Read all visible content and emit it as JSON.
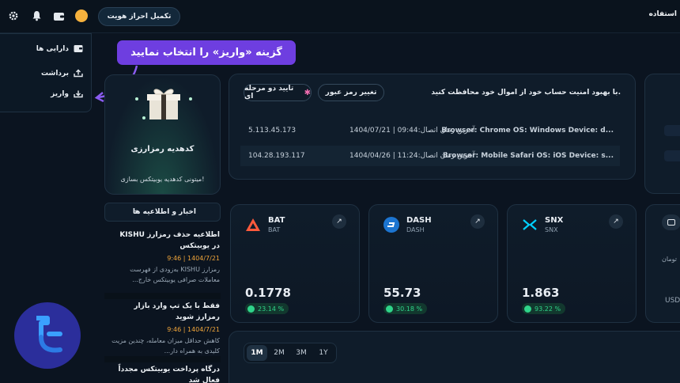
{
  "header": {
    "verify_button": "تکمیل احراز هویت",
    "user_label": "استفاده"
  },
  "menu": {
    "items": [
      {
        "label": "دارایی ها",
        "icon": "wallet-icon"
      },
      {
        "label": "برداشت",
        "icon": "upload-icon"
      },
      {
        "label": "واریز",
        "icon": "download-icon"
      }
    ]
  },
  "callout": {
    "text": "گزینه «واریز» را انتخاب نمایید"
  },
  "gift_card": {
    "title": "کدهدیه رمزارزی",
    "subtitle": "میتونی کدهدیه یوبیتکس بسازی!"
  },
  "security": {
    "message": "با بهبود امنیت حساب خود از اموال خود محافظت کنید.",
    "change_password": "تغییر رمز عبور",
    "two_factor": "تایید دو مرحله ای",
    "sessions": [
      {
        "browser": "Browser: Chrome OS: Windows Device: d...",
        "last_login": "آخرین زمان اتصال:09:44 | 1404/07/21",
        "ip": "5.113.45.173"
      },
      {
        "browser": "Browser: Mobile Safari OS: iOS Device: s...",
        "last_login": "آخرین زمان اتصال:11:24 | 1404/04/26",
        "ip": "104.28.193.117"
      }
    ]
  },
  "news": {
    "header": "اخبار و اطلاعیه ها",
    "items": [
      {
        "title": "اطلاعیه حذف رمزارز KISHU در یوبیتکس",
        "date": "9:46 | 1404/7/21",
        "body": "رمزارز KISHU به‌زودی از فهرست معاملات صرافی یوبیتکس خارج..."
      },
      {
        "title": "فقط با یک تپ وارد بازار رمزارز شوید",
        "date": "9:46 | 1404/7/21",
        "body": "کاهش حداقل میزان معامله، چندین مزیت کلیدی به همراه دار..."
      },
      {
        "title": "درگاه پرداخت یوبیتکس مجدداً فعال شد",
        "date": "",
        "body": ""
      }
    ]
  },
  "coins": [
    {
      "symbol": "BAT",
      "name": "BAT",
      "price": "0.1778",
      "change": "23.14 %",
      "icon": "bat-triangle-icon",
      "color": "#ff5a3c"
    },
    {
      "symbol": "DASH",
      "name": "DASH",
      "price": "55.73",
      "change": "30.18 %",
      "icon": "dash-icon",
      "color": "#1c75d1"
    },
    {
      "symbol": "SNX",
      "name": "SNX",
      "price": "1.863",
      "change": "93.22 %",
      "icon": "snx-icon",
      "color": "#00d1ff"
    }
  ],
  "side_stub": {
    "label": "تومان",
    "code": "USD"
  },
  "chart": {
    "ranges": [
      "1M",
      "2M",
      "3M",
      "1Y"
    ],
    "active_range": "1M"
  }
}
